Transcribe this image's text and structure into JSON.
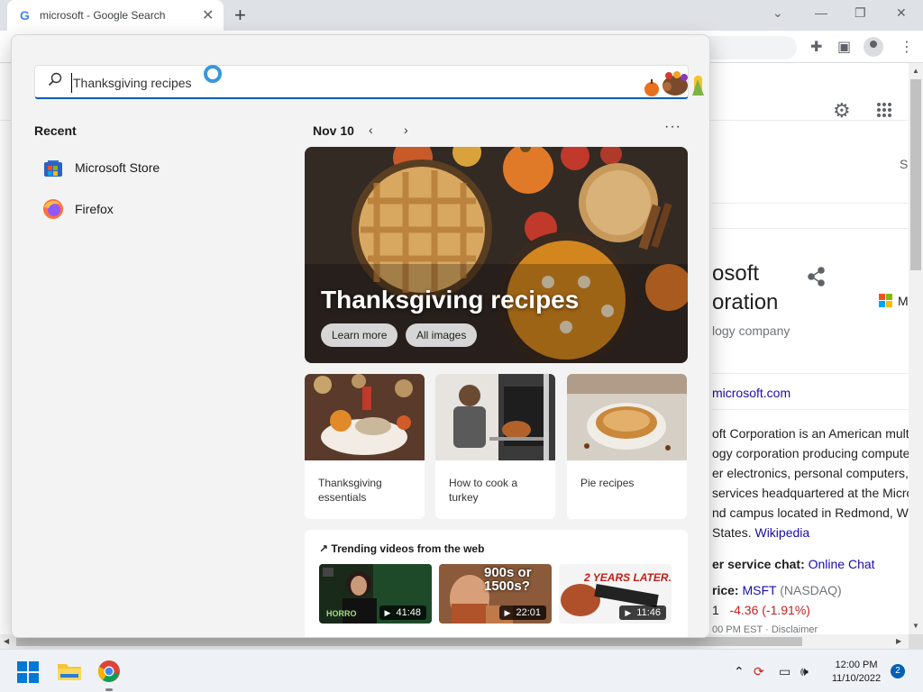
{
  "browser": {
    "tab_title": "microsoft - Google Search",
    "new_tab": "+",
    "close_tab": "✕"
  },
  "google": {
    "kp_title_line1": "osoft",
    "kp_title_line2": "oration",
    "kp_subtitle": "logy company",
    "kp_site": "microsoft.com",
    "kp_desc": [
      "oft Corporation is an American multi",
      "ogy corporation producing compute",
      "er electronics, personal computers,",
      "services headquartered at the Micro",
      "nd campus located in Redmond, Wa",
      "States."
    ],
    "kp_wiki": "Wikipedia",
    "kp_chat_label": "er service chat:",
    "kp_chat_link": "Online Chat",
    "kp_price_label": "rice:",
    "kp_ticker": "MSFT",
    "kp_exchange": "(NASDAQ)",
    "kp_price_tail": "1",
    "kp_change": "-4.36 (-1.91%)",
    "kp_disclaimer": "00 PM EST · Disclaimer",
    "kp_logo_letter": "M",
    "right_letter": "S"
  },
  "search_flyout": {
    "query": "Thanksgiving recipes",
    "recent_title": "Recent",
    "recent_items": [
      {
        "label": "Microsoft Store",
        "icon": "store-icon"
      },
      {
        "label": "Firefox",
        "icon": "firefox-icon"
      }
    ],
    "date": "Nov 10",
    "hero": {
      "title": "Thanksgiving recipes",
      "learn_more": "Learn more",
      "all_images": "All images"
    },
    "cards": [
      {
        "label": "Thanksgiving essentials"
      },
      {
        "label": "How to cook a turkey"
      },
      {
        "label": "Pie recipes"
      }
    ],
    "trending_title": "Trending videos from the web",
    "videos": [
      {
        "duration": "41:48",
        "overlay": "HORRO"
      },
      {
        "duration": "22:01",
        "overlay": "900s or 1500s?"
      },
      {
        "duration": "11:46",
        "overlay": "2 YEARS LATER..."
      }
    ]
  },
  "taskbar": {
    "time": "12:00 PM",
    "date": "11/10/2022",
    "notifications": "2"
  },
  "colors": {
    "accent": "#005fb8",
    "link": "#1a0dab",
    "down": "#c5221f"
  }
}
